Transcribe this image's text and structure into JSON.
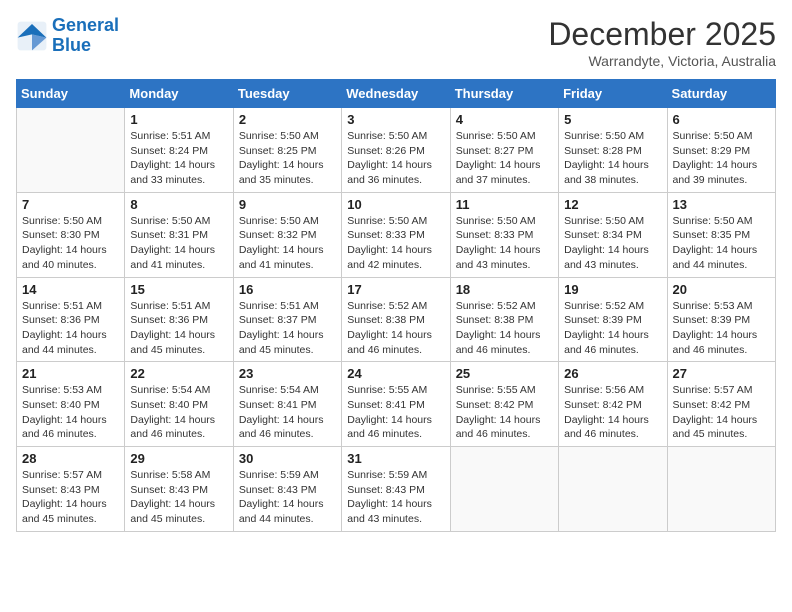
{
  "logo": {
    "line1": "General",
    "line2": "Blue"
  },
  "title": "December 2025",
  "subtitle": "Warrandyte, Victoria, Australia",
  "days_header": [
    "Sunday",
    "Monday",
    "Tuesday",
    "Wednesday",
    "Thursday",
    "Friday",
    "Saturday"
  ],
  "weeks": [
    [
      {
        "day": "",
        "info": ""
      },
      {
        "day": "1",
        "info": "Sunrise: 5:51 AM\nSunset: 8:24 PM\nDaylight: 14 hours\nand 33 minutes."
      },
      {
        "day": "2",
        "info": "Sunrise: 5:50 AM\nSunset: 8:25 PM\nDaylight: 14 hours\nand 35 minutes."
      },
      {
        "day": "3",
        "info": "Sunrise: 5:50 AM\nSunset: 8:26 PM\nDaylight: 14 hours\nand 36 minutes."
      },
      {
        "day": "4",
        "info": "Sunrise: 5:50 AM\nSunset: 8:27 PM\nDaylight: 14 hours\nand 37 minutes."
      },
      {
        "day": "5",
        "info": "Sunrise: 5:50 AM\nSunset: 8:28 PM\nDaylight: 14 hours\nand 38 minutes."
      },
      {
        "day": "6",
        "info": "Sunrise: 5:50 AM\nSunset: 8:29 PM\nDaylight: 14 hours\nand 39 minutes."
      }
    ],
    [
      {
        "day": "7",
        "info": "Sunrise: 5:50 AM\nSunset: 8:30 PM\nDaylight: 14 hours\nand 40 minutes."
      },
      {
        "day": "8",
        "info": "Sunrise: 5:50 AM\nSunset: 8:31 PM\nDaylight: 14 hours\nand 41 minutes."
      },
      {
        "day": "9",
        "info": "Sunrise: 5:50 AM\nSunset: 8:32 PM\nDaylight: 14 hours\nand 41 minutes."
      },
      {
        "day": "10",
        "info": "Sunrise: 5:50 AM\nSunset: 8:33 PM\nDaylight: 14 hours\nand 42 minutes."
      },
      {
        "day": "11",
        "info": "Sunrise: 5:50 AM\nSunset: 8:33 PM\nDaylight: 14 hours\nand 43 minutes."
      },
      {
        "day": "12",
        "info": "Sunrise: 5:50 AM\nSunset: 8:34 PM\nDaylight: 14 hours\nand 43 minutes."
      },
      {
        "day": "13",
        "info": "Sunrise: 5:50 AM\nSunset: 8:35 PM\nDaylight: 14 hours\nand 44 minutes."
      }
    ],
    [
      {
        "day": "14",
        "info": "Sunrise: 5:51 AM\nSunset: 8:36 PM\nDaylight: 14 hours\nand 44 minutes."
      },
      {
        "day": "15",
        "info": "Sunrise: 5:51 AM\nSunset: 8:36 PM\nDaylight: 14 hours\nand 45 minutes."
      },
      {
        "day": "16",
        "info": "Sunrise: 5:51 AM\nSunset: 8:37 PM\nDaylight: 14 hours\nand 45 minutes."
      },
      {
        "day": "17",
        "info": "Sunrise: 5:52 AM\nSunset: 8:38 PM\nDaylight: 14 hours\nand 46 minutes."
      },
      {
        "day": "18",
        "info": "Sunrise: 5:52 AM\nSunset: 8:38 PM\nDaylight: 14 hours\nand 46 minutes."
      },
      {
        "day": "19",
        "info": "Sunrise: 5:52 AM\nSunset: 8:39 PM\nDaylight: 14 hours\nand 46 minutes."
      },
      {
        "day": "20",
        "info": "Sunrise: 5:53 AM\nSunset: 8:39 PM\nDaylight: 14 hours\nand 46 minutes."
      }
    ],
    [
      {
        "day": "21",
        "info": "Sunrise: 5:53 AM\nSunset: 8:40 PM\nDaylight: 14 hours\nand 46 minutes."
      },
      {
        "day": "22",
        "info": "Sunrise: 5:54 AM\nSunset: 8:40 PM\nDaylight: 14 hours\nand 46 minutes."
      },
      {
        "day": "23",
        "info": "Sunrise: 5:54 AM\nSunset: 8:41 PM\nDaylight: 14 hours\nand 46 minutes."
      },
      {
        "day": "24",
        "info": "Sunrise: 5:55 AM\nSunset: 8:41 PM\nDaylight: 14 hours\nand 46 minutes."
      },
      {
        "day": "25",
        "info": "Sunrise: 5:55 AM\nSunset: 8:42 PM\nDaylight: 14 hours\nand 46 minutes."
      },
      {
        "day": "26",
        "info": "Sunrise: 5:56 AM\nSunset: 8:42 PM\nDaylight: 14 hours\nand 46 minutes."
      },
      {
        "day": "27",
        "info": "Sunrise: 5:57 AM\nSunset: 8:42 PM\nDaylight: 14 hours\nand 45 minutes."
      }
    ],
    [
      {
        "day": "28",
        "info": "Sunrise: 5:57 AM\nSunset: 8:43 PM\nDaylight: 14 hours\nand 45 minutes."
      },
      {
        "day": "29",
        "info": "Sunrise: 5:58 AM\nSunset: 8:43 PM\nDaylight: 14 hours\nand 45 minutes."
      },
      {
        "day": "30",
        "info": "Sunrise: 5:59 AM\nSunset: 8:43 PM\nDaylight: 14 hours\nand 44 minutes."
      },
      {
        "day": "31",
        "info": "Sunrise: 5:59 AM\nSunset: 8:43 PM\nDaylight: 14 hours\nand 43 minutes."
      },
      {
        "day": "",
        "info": ""
      },
      {
        "day": "",
        "info": ""
      },
      {
        "day": "",
        "info": ""
      }
    ]
  ]
}
